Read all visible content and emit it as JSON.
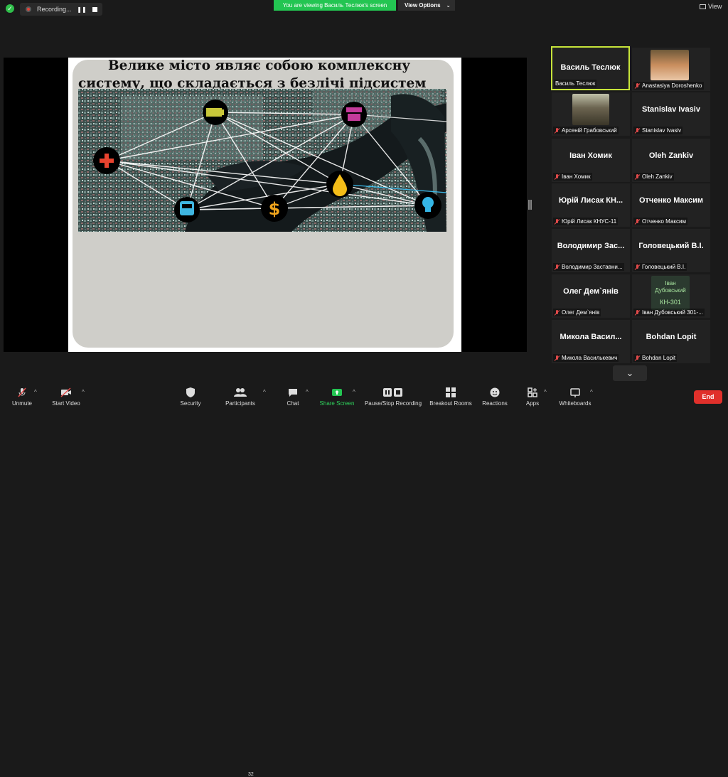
{
  "topbar": {
    "recording_label": "Recording...",
    "viewing_banner": "You are viewing Василь Теслюк's screen",
    "view_options_label": "View Options",
    "view_label": "View"
  },
  "slide": {
    "title_line1": "Велике місто являє собою комплексну",
    "title_line2": "систему, що складається з безлічі підсистем"
  },
  "participants": [
    {
      "tile_name": "Василь Теслюк",
      "label": "Василь Теслюк",
      "muted": false,
      "active": true,
      "photo": false
    },
    {
      "tile_name": "",
      "label": "Anastasiya Doroshenko",
      "muted": true,
      "active": false,
      "photo": true
    },
    {
      "tile_name": "",
      "label": "Арсеній Грабовський",
      "muted": true,
      "active": false,
      "photo": true
    },
    {
      "tile_name": "Stanislav Ivasiv",
      "label": "Stanislav Ivasiv",
      "muted": true,
      "active": false,
      "photo": false
    },
    {
      "tile_name": "Іван Хомик",
      "label": "Іван Хомик",
      "muted": true,
      "active": false,
      "photo": false
    },
    {
      "tile_name": "Oleh Zankiv",
      "label": "Oleh Zankiv",
      "muted": true,
      "active": false,
      "photo": false
    },
    {
      "tile_name": "Юрій Лисак КН...",
      "label": "Юрій Лисак КНУС-11",
      "muted": true,
      "active": false,
      "photo": false
    },
    {
      "tile_name": "Отченко Максим",
      "label": "Отченко Максим",
      "muted": true,
      "active": false,
      "photo": false
    },
    {
      "tile_name": "Володимир Зас...",
      "label": "Володимир Заставни...",
      "muted": true,
      "active": false,
      "photo": false
    },
    {
      "tile_name": "Головецький В.І.",
      "label": "Головецький В.І.",
      "muted": true,
      "active": false,
      "photo": false
    },
    {
      "tile_name": "Олег Дем`янів",
      "label": "Олег Дем`янів",
      "muted": true,
      "active": false,
      "photo": false
    },
    {
      "tile_name": "",
      "label": "Іван Дубовський 301-...",
      "muted": true,
      "active": false,
      "photo": true
    },
    {
      "tile_name": "Микола Васил...",
      "label": "Микола Василькевич",
      "muted": true,
      "active": false,
      "photo": false
    },
    {
      "tile_name": "Bohdan Lopit",
      "label": "Bohdan Lopit",
      "muted": true,
      "active": false,
      "photo": false
    }
  ],
  "photo_text": {
    "ivan_line1": "Іван",
    "ivan_line2": "Дубовський",
    "ivan_line3": "КН-301"
  },
  "toolbar": {
    "unmute": "Unmute",
    "start_video": "Start Video",
    "security": "Security",
    "participants": "Participants",
    "participants_count": "32",
    "chat": "Chat",
    "share_screen": "Share Screen",
    "pause_stop": "Pause/Stop Recording",
    "breakout": "Breakout Rooms",
    "reactions": "Reactions",
    "apps": "Apps",
    "whiteboards": "Whiteboards",
    "end": "End"
  },
  "colors": {
    "accent_green": "#23c552",
    "active_border": "#c7e43a",
    "end_red": "#e0302b",
    "muted_red": "#e14a4a"
  }
}
